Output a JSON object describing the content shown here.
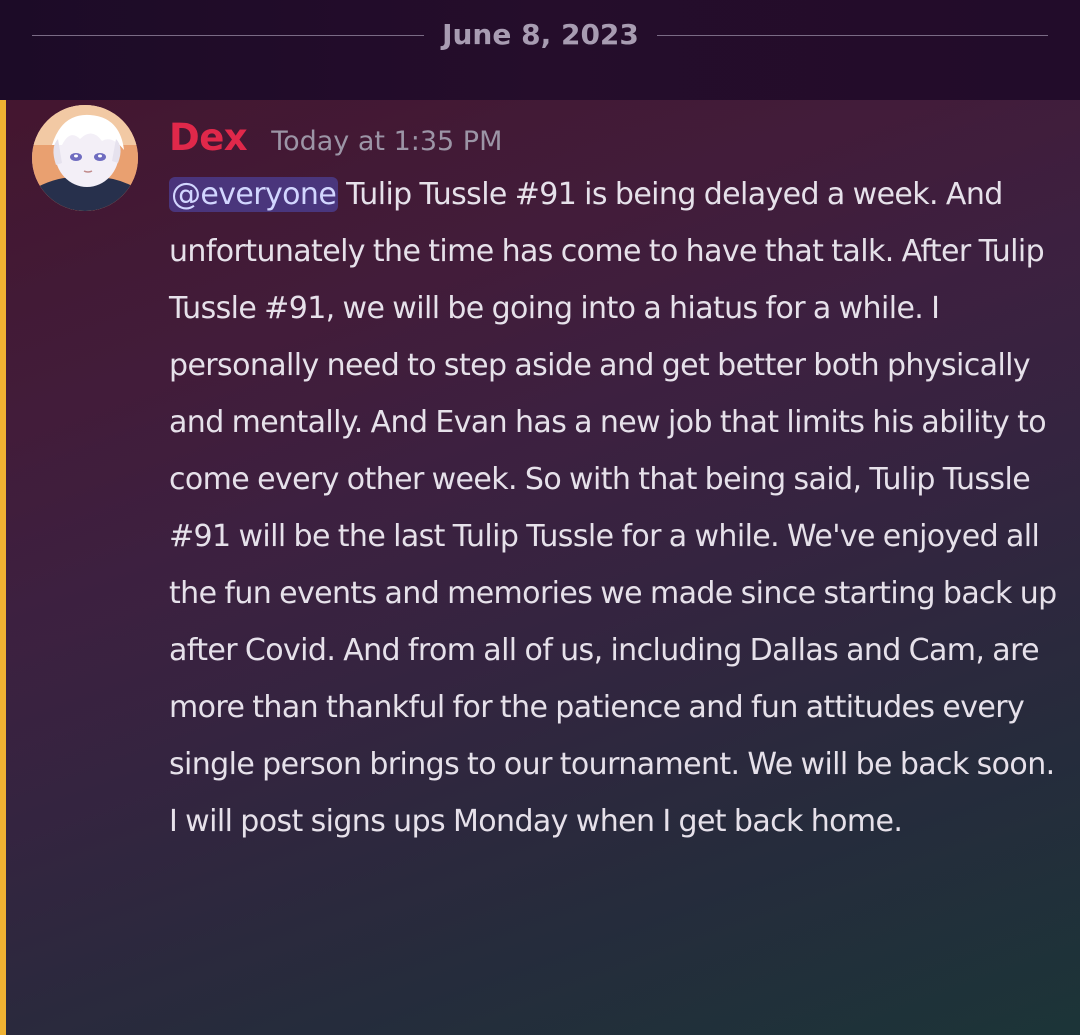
{
  "date_divider": {
    "label": "June 8, 2023"
  },
  "message": {
    "author": "Dex",
    "author_color": "#e0284a",
    "timestamp": "Today at 1:35 PM",
    "highlight_color": "#f0b232",
    "mention": "@everyone",
    "body": " Tulip Tussle #91 is being delayed a week. And unfortunately the time has come to have that talk. After Tulip Tussle #91, we will be going into a hiatus for a while. I personally need to step aside and get better both physically and mentally. And Evan has a new job that limits his ability to come every other week. So with that being said, Tulip Tussle #91 will be the last Tulip Tussle for a while. We've enjoyed all the fun events and memories we made since starting back up after Covid. And from all of us, including Dallas and Cam, are more than thankful for the patience and fun attitudes every single person brings to our tournament. We will be back soon. I will post signs ups Monday when I get back home.",
    "avatar_icon": "anime-character-avatar"
  }
}
